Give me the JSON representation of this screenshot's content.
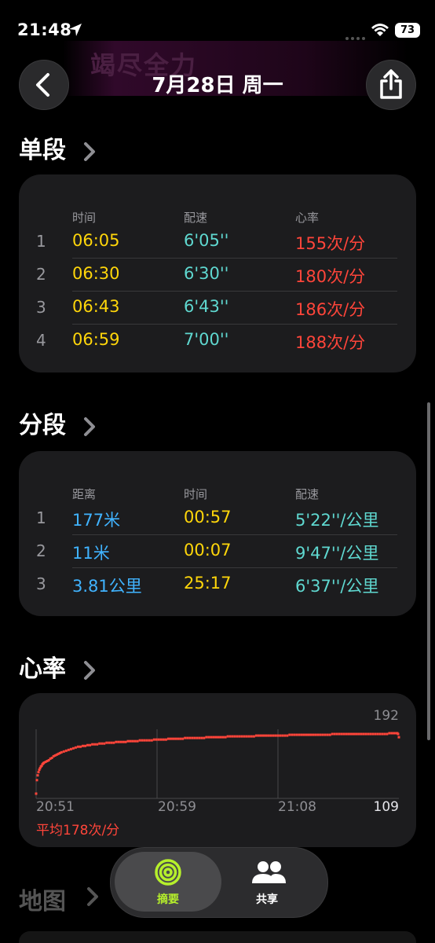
{
  "status_bar": {
    "time": "21:48",
    "battery": "73"
  },
  "banner": {
    "text": "竭尽全力"
  },
  "header": {
    "title": "7月28日 周一"
  },
  "intervals": {
    "title": "单段",
    "columns": [
      "时间",
      "配速",
      "心率"
    ],
    "rows": [
      {
        "num": "1",
        "time": "06:05",
        "pace": "6'05''",
        "hr": "155次/分"
      },
      {
        "num": "2",
        "time": "06:30",
        "pace": "6'30''",
        "hr": "180次/分"
      },
      {
        "num": "3",
        "time": "06:43",
        "pace": "6'43''",
        "hr": "186次/分"
      },
      {
        "num": "4",
        "time": "06:59",
        "pace": "7'00''",
        "hr": "188次/分"
      }
    ]
  },
  "splits": {
    "title": "分段",
    "columns": [
      "距离",
      "时间",
      "配速"
    ],
    "rows": [
      {
        "num": "1",
        "distance": "177米",
        "time": "00:57",
        "pace": "5'22''/公里"
      },
      {
        "num": "2",
        "distance": "11米",
        "time": "00:07",
        "pace": "9'47''/公里"
      },
      {
        "num": "3",
        "distance": "3.81公里",
        "time": "25:17",
        "pace": "6'37''/公里"
      }
    ]
  },
  "heart_rate": {
    "title": "心率",
    "average": "平均178次/分",
    "colors": {
      "line": "#ff453a"
    }
  },
  "chart_data": {
    "type": "scatter",
    "x_ticks": [
      "20:51",
      "20:59",
      "21:08"
    ],
    "y_max_label": "192",
    "y_min_label": "109",
    "ylim": [
      109,
      192
    ],
    "x": [
      0,
      1,
      2,
      3,
      4,
      5,
      6,
      7,
      8,
      9,
      10,
      12,
      14,
      16,
      18,
      20,
      22,
      24,
      26,
      28,
      30,
      32,
      35,
      38,
      41,
      44,
      47,
      50,
      53,
      56,
      59,
      62,
      65,
      68,
      71,
      74,
      77,
      80,
      83,
      86,
      89,
      92,
      95,
      98,
      101,
      104,
      107,
      110,
      113,
      116,
      119,
      122,
      125,
      128,
      131,
      134,
      137,
      140,
      143,
      146,
      149,
      152,
      155,
      158,
      161,
      164,
      167,
      170,
      173,
      176,
      179,
      182,
      185,
      188,
      191,
      194,
      197,
      200,
      203,
      206,
      209,
      212,
      215,
      218,
      221,
      224,
      227,
      230,
      233,
      236,
      239,
      242,
      245,
      248,
      251,
      254,
      257,
      260,
      263,
      266,
      269,
      272,
      275,
      278,
      281,
      284,
      287,
      290,
      293,
      296,
      299,
      302,
      305,
      308,
      311,
      314,
      317,
      320,
      323,
      326,
      329,
      332,
      335,
      338,
      341,
      344,
      347,
      350,
      353,
      356,
      359,
      362,
      365,
      368,
      371,
      374,
      377,
      380,
      383,
      386,
      389,
      392,
      395,
      398,
      401,
      404,
      407,
      410,
      413,
      416,
      419,
      422,
      425,
      428,
      431,
      434,
      437,
      440,
      443,
      446,
      449,
      452,
      455,
      456,
      457,
      458
    ],
    "values": [
      113,
      130,
      136,
      140,
      143,
      145,
      147,
      148,
      150,
      151,
      152,
      153,
      154,
      155,
      157,
      158,
      160,
      161,
      162,
      163,
      164,
      165,
      166,
      167,
      168,
      169,
      170,
      171,
      172,
      172,
      173,
      173,
      174,
      174,
      175,
      175,
      175,
      176,
      176,
      176,
      177,
      177,
      177,
      177,
      178,
      178,
      178,
      178,
      178,
      179,
      179,
      179,
      179,
      179,
      180,
      180,
      180,
      180,
      180,
      180,
      181,
      181,
      181,
      181,
      181,
      181,
      182,
      182,
      182,
      182,
      182,
      182,
      182,
      183,
      183,
      183,
      183,
      183,
      183,
      183,
      183,
      183,
      184,
      184,
      184,
      184,
      184,
      184,
      184,
      184,
      184,
      185,
      185,
      185,
      185,
      185,
      185,
      185,
      185,
      185,
      185,
      185,
      185,
      186,
      186,
      186,
      186,
      186,
      186,
      186,
      186,
      186,
      186,
      186,
      186,
      186,
      186,
      187,
      187,
      187,
      187,
      187,
      187,
      187,
      187,
      187,
      187,
      187,
      187,
      187,
      187,
      187,
      187,
      187,
      187,
      188,
      188,
      188,
      188,
      188,
      188,
      188,
      188,
      188,
      188,
      188,
      188,
      188,
      188,
      188,
      188,
      188,
      188,
      188,
      188,
      188,
      188,
      188,
      188,
      189,
      189,
      189,
      189,
      189,
      188,
      184,
      179
    ]
  },
  "tabbar": {
    "tabs": [
      {
        "label": "摘要",
        "active": true
      },
      {
        "label": "共享",
        "active": false
      }
    ]
  },
  "map": {
    "title": "地图"
  }
}
